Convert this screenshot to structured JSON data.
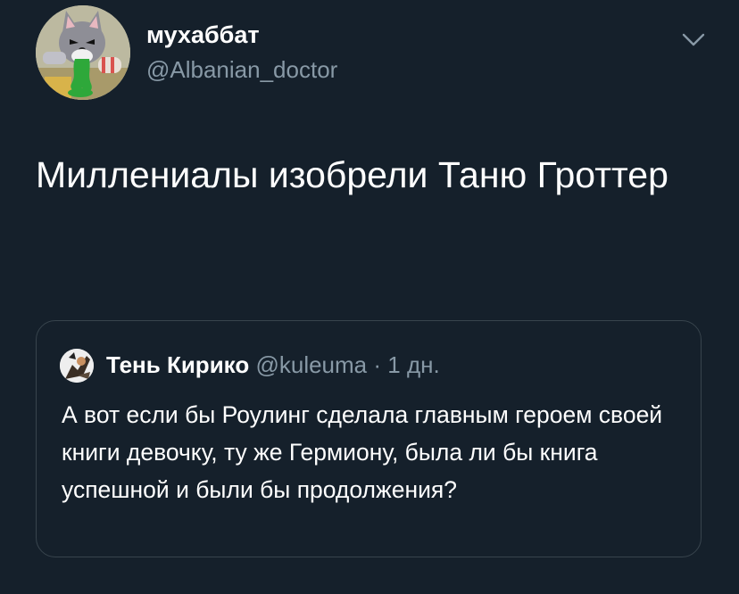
{
  "tweet": {
    "author_name": "мухаббат",
    "author_handle": "@Albanian_doctor",
    "text": "Миллениалы изобрели Таню Гроттер",
    "avatar_icon": "crying-cat-avatar",
    "menu_icon": "chevron-down-icon"
  },
  "quote": {
    "author_name": "Тень Кирико",
    "author_handle": "@kuleuma",
    "separator": "·",
    "time": "1 дн.",
    "avatar_icon": "character-avatar",
    "text": "А вот если бы Роулинг сделала главным героем своей книги девочку, ту же Гермиону, была ли бы книга успешной и были бы продолжения?"
  },
  "colors": {
    "background": "#15202b",
    "secondary_text": "#8899a6",
    "border": "#38444d"
  }
}
